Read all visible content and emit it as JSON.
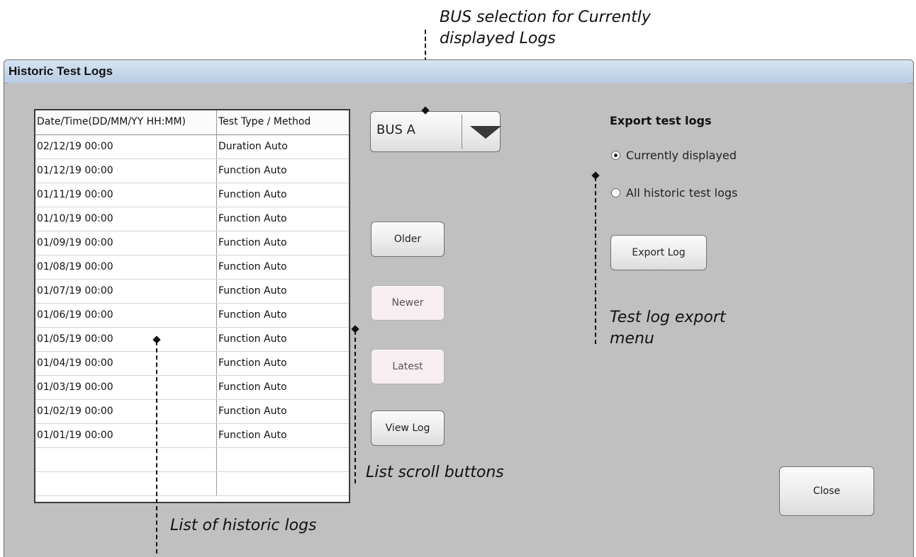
{
  "window": {
    "title": "Historic Test Logs"
  },
  "log_table": {
    "columns": [
      "Date/Time(DD/MM/YY HH:MM)",
      "Test Type / Method"
    ],
    "rows": [
      [
        "02/12/19 00:00",
        "Duration Auto"
      ],
      [
        "01/12/19 00:00",
        "Function Auto"
      ],
      [
        "01/11/19 00:00",
        "Function Auto"
      ],
      [
        "01/10/19 00:00",
        "Function Auto"
      ],
      [
        "01/09/19 00:00",
        "Function Auto"
      ],
      [
        "01/08/19 00:00",
        "Function Auto"
      ],
      [
        "01/07/19 00:00",
        "Function Auto"
      ],
      [
        "01/06/19 00:00",
        "Function Auto"
      ],
      [
        "01/05/19 00:00",
        "Function Auto"
      ],
      [
        "01/04/19 00:00",
        "Function Auto"
      ],
      [
        "01/03/19 00:00",
        "Function Auto"
      ],
      [
        "01/02/19 00:00",
        "Function Auto"
      ],
      [
        "01/01/19 00:00",
        "Function Auto"
      ],
      [
        "",
        ""
      ],
      [
        "",
        ""
      ]
    ]
  },
  "bus_select": {
    "value": "BUS A",
    "icon": "dropdown-arrow-icon"
  },
  "scroll_buttons": {
    "older": "Older",
    "newer": "Newer",
    "latest": "Latest",
    "view_log": "View Log"
  },
  "export": {
    "title": "Export test logs",
    "options": [
      {
        "label": "Currently displayed",
        "selected": true
      },
      {
        "label": "All historic test logs",
        "selected": false
      }
    ],
    "button": "Export Log"
  },
  "close_button": "Close",
  "annotations": {
    "bus_selection": [
      "BUS selection for Currently",
      "displayed Logs"
    ],
    "export_menu": [
      "Test log export",
      "menu"
    ],
    "scroll_buttons": "List scroll buttons",
    "historic_list": "List of historic logs"
  }
}
